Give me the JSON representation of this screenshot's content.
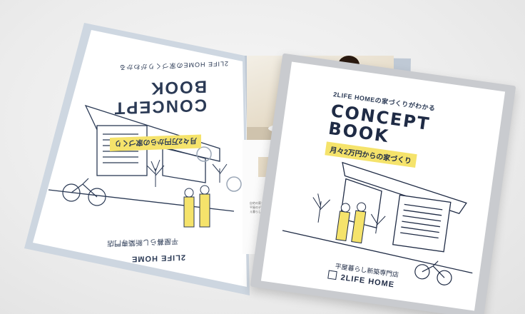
{
  "back_book": {
    "brand_tag": "2LIFE HOMEの家づくりがわかる",
    "title_line1": "CONCEPT",
    "title_line2": "BOOK",
    "subtitle": "月々2万円からの家づくり",
    "footer_jp": "平屋暮らし新築専門店",
    "footer_brand": "2LIFE HOME"
  },
  "front_book": {
    "brand_tag": "2LIFE HOMEの家づくりがわかる",
    "title_line1": "CONCEPT",
    "title_line2": "BOOK",
    "subtitle": "月々2万円からの家づくり",
    "footer_jp": "平屋暮らし新築専門店",
    "footer_brand": "2LIFE HOME"
  },
  "insert": {
    "paragraph_heading": "自宅の家づくり",
    "paragraph_text": "平屋のデザインが家族の理想を叶え暮らしを豊かにする"
  },
  "colors": {
    "navy": "#1f2b45",
    "highlight_yellow": "#f5e36b",
    "folder_blue": "#c8d2de"
  }
}
